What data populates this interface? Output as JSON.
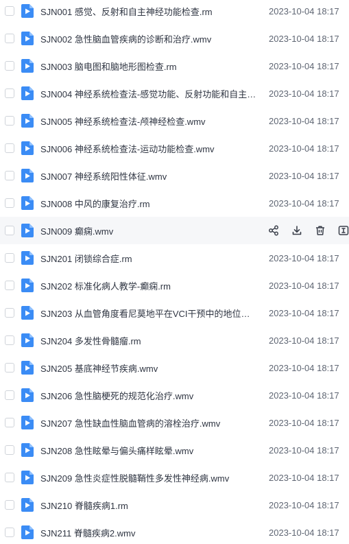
{
  "files": [
    {
      "name": "SJN001 感觉、反射和自主神经功能检查.rm",
      "date": "2023-10-04 18:17"
    },
    {
      "name": "SJN002 急性脑血管疾病的诊断和治疗.wmv",
      "date": "2023-10-04 18:17"
    },
    {
      "name": "SJN003 脑电图和脑地形图检查.rm",
      "date": "2023-10-04 18:17"
    },
    {
      "name": "SJN004 神经系统检查法-感觉功能、反射功能和自主神经...",
      "date": "2023-10-04 18:17"
    },
    {
      "name": "SJN005 神经系统检查法-颅神经检查.wmv",
      "date": "2023-10-04 18:17"
    },
    {
      "name": "SJN006 神经系统检查法-运动功能检查.wmv",
      "date": "2023-10-04 18:17"
    },
    {
      "name": "SJN007 神经系统阳性体征.wmv",
      "date": "2023-10-04 18:17"
    },
    {
      "name": "SJN008 中风的康复治疗.rm",
      "date": "2023-10-04 18:17"
    },
    {
      "name": "SJN009 癫痫.wmv",
      "date": ""
    },
    {
      "name": "SJN201 闭锁综合症.rm",
      "date": "2023-10-04 18:17"
    },
    {
      "name": "SJN202 标准化病人教学-癫痫.rm",
      "date": "2023-10-04 18:17"
    },
    {
      "name": "SJN203 从血管角度看尼莫地平在VCI干预中的地位及作...",
      "date": "2023-10-04 18:17"
    },
    {
      "name": "SJN204 多发性骨髓瘤.rm",
      "date": "2023-10-04 18:17"
    },
    {
      "name": "SJN205 基底神经节疾病.wmv",
      "date": "2023-10-04 18:17"
    },
    {
      "name": "SJN206 急性脑梗死的规范化治疗.wmv",
      "date": "2023-10-04 18:17"
    },
    {
      "name": "SJN207 急性缺血性脑血管病的溶栓治疗.wmv",
      "date": "2023-10-04 18:17"
    },
    {
      "name": "SJN208 急性眩晕与偏头痛样眩晕.wmv",
      "date": "2023-10-04 18:17"
    },
    {
      "name": "SJN209 急性炎症性脱髓鞘性多发性神经病.wmv",
      "date": "2023-10-04 18:17"
    },
    {
      "name": "SJN210 脊髓疾病1.rm",
      "date": "2023-10-04 18:17"
    },
    {
      "name": "SJN211 脊髓疾病2.wmv",
      "date": "2023-10-04 18:17"
    }
  ],
  "hover_row_index": 8,
  "hover_actions": [
    "share-icon",
    "download-icon",
    "delete-icon",
    "rename-icon"
  ],
  "colors": {
    "accent": "#3b8cf5",
    "hover_bg": "#f6f7f9",
    "text": "#2f3542",
    "date": "#5f6673"
  }
}
